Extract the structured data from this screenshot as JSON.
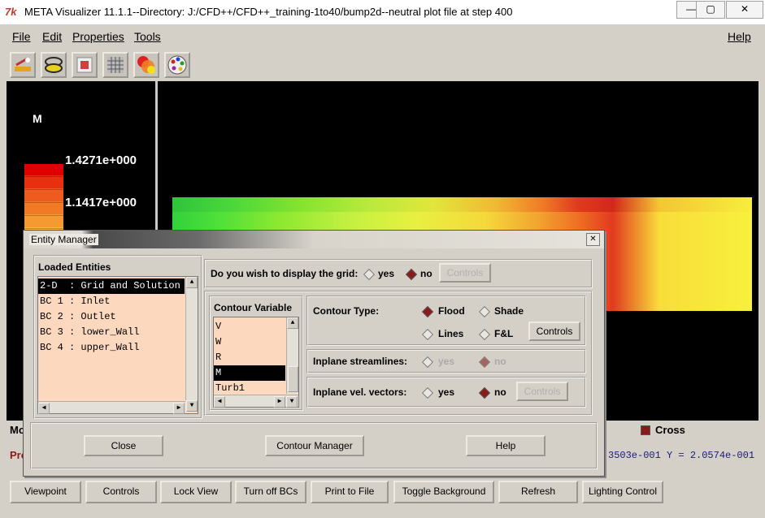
{
  "window": {
    "title": "META Visualizer 11.1.1--Directory: J:/CFD++/CFD++_training-1to40/bump2d--neutral plot file at step 400",
    "icon_text": "7k",
    "minimize": "—",
    "restore": "▢",
    "close": "✕"
  },
  "menu": [
    {
      "label": "File"
    },
    {
      "label": "Edit"
    },
    {
      "label": "Properties"
    },
    {
      "label": "Tools"
    },
    {
      "label": "Help"
    }
  ],
  "toolbar_icons": [
    "plot-icon",
    "streamlines-icon",
    "surface-icon",
    "grid-icon",
    "contour-icon",
    "palette-icon"
  ],
  "legend": {
    "title": "M",
    "values": [
      "1.4271e+000",
      "1.1417e+000"
    ],
    "colors": [
      "#e00000",
      "#e83010",
      "#ef5a1e",
      "#f27a26",
      "#f49a30",
      "#f7b83a"
    ]
  },
  "status": {
    "mode_label": "Mo",
    "cross_label": "Cross",
    "probe_label": "Pro",
    "coord_readout": "3503e-001  Y = 2.0574e-001"
  },
  "bottom_buttons": [
    "Viewpoint",
    "Controls",
    "Lock View",
    "Turn off BCs",
    "Print to File",
    "Toggle Background",
    "Refresh",
    "Lighting Control"
  ],
  "dialog": {
    "title": "Entity Manager",
    "close": "✕",
    "loaded_entities_label": "Loaded Entities",
    "entities": [
      "2-D  : Grid and Solution",
      "BC 1 : Inlet",
      "BC 2 : Outlet",
      "BC 3 : lower_Wall",
      "BC 4 : upper_Wall"
    ],
    "grid_question": "Do you wish to display the grid:",
    "grid_yes": "yes",
    "grid_no": "no",
    "grid_controls": "Controls",
    "contour_variable_label": "Contour Variable",
    "variables": [
      "V",
      "W",
      "R",
      "M",
      "Turb1"
    ],
    "contour_type_label": "Contour Type:",
    "flood": "Flood",
    "shade": "Shade",
    "lines": "Lines",
    "fl": "F&L",
    "contour_controls": "Controls",
    "streamlines_label": "Inplane streamlines:",
    "streamlines_yes": "yes",
    "streamlines_no": "no",
    "vectors_label": "Inplane vel. vectors:",
    "vectors_yes": "yes",
    "vectors_no": "no",
    "vectors_controls": "Controls",
    "close_button": "Close",
    "contour_manager_button": "Contour Manager",
    "help_button": "Help"
  }
}
